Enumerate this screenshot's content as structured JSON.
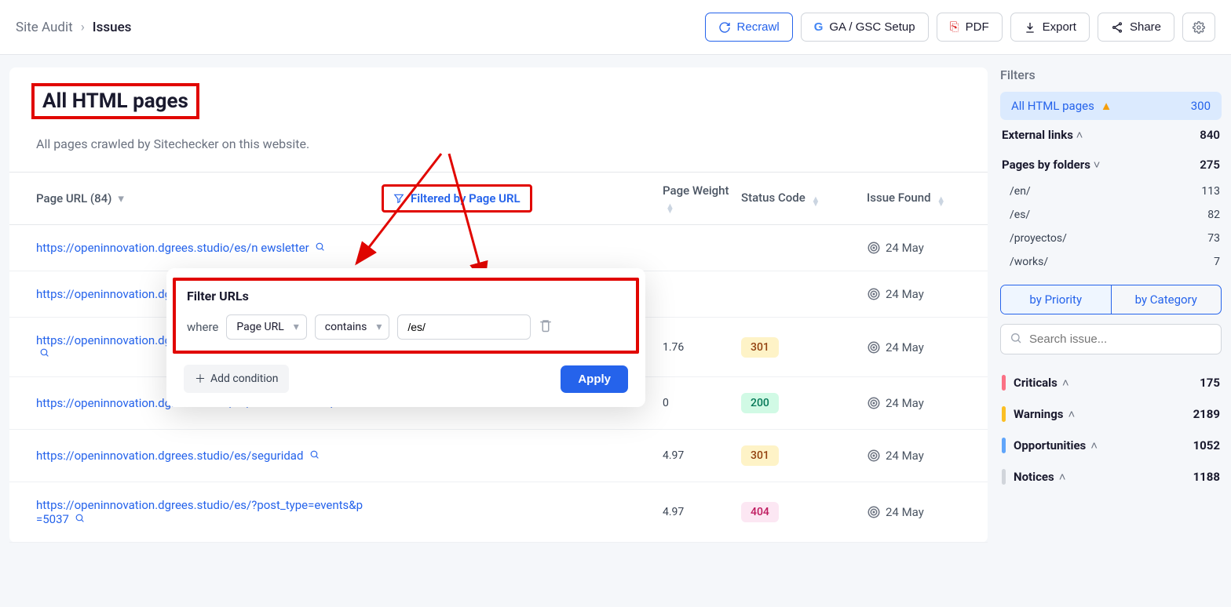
{
  "breadcrumb": {
    "site_audit": "Site Audit",
    "issues": "Issues"
  },
  "actions": {
    "recrawl": "Recrawl",
    "ga_gsc": "GA / GSC Setup",
    "pdf": "PDF",
    "export": "Export",
    "share": "Share"
  },
  "page": {
    "title": "All HTML pages",
    "description": "All pages crawled by Sitechecker on this website."
  },
  "columns": {
    "url": "Page URL (84)",
    "filtered": "Filtered by Page URL",
    "weight": "Page Weight",
    "status": "Status Code",
    "issue": "Issue Found"
  },
  "filter_popup": {
    "title": "Filter URLs",
    "where": "where",
    "field": "Page URL",
    "operator": "contains",
    "value": "/es/",
    "add_condition": "Add condition",
    "apply": "Apply"
  },
  "rows": [
    {
      "url": "https://openinnovation.dgrees.studio/es/n ewsletter",
      "weight": "",
      "status": "",
      "date": "24 May"
    },
    {
      "url": "https://openinnovation.dgrees.studio/es/work s",
      "weight": "",
      "status": "",
      "date": "24 May"
    },
    {
      "url": "https://openinnovation.dgrees.studio/es/tratamiento-de-datos",
      "weight": "1.76",
      "status": "301",
      "date": "24 May"
    },
    {
      "url": "https://openinnovation.dgrees.studio/es/sobre-nosotros/",
      "weight": "0",
      "status": "200",
      "date": "24 May"
    },
    {
      "url": "https://openinnovation.dgrees.studio/es/seguridad",
      "weight": "4.97",
      "status": "301",
      "date": "24 May"
    },
    {
      "url": "https://openinnovation.dgrees.studio/es/?post_type=events&p=5037",
      "weight": "4.97",
      "status": "404",
      "date": "24 May"
    }
  ],
  "sidebar": {
    "filters_title": "Filters",
    "all_html": {
      "label": "All HTML pages",
      "count": "300"
    },
    "external_links": {
      "label": "External links",
      "count": "840"
    },
    "pages_by_folders": {
      "label": "Pages by folders",
      "count": "275"
    },
    "folders": [
      {
        "name": "/en/",
        "count": "113"
      },
      {
        "name": "/es/",
        "count": "82"
      },
      {
        "name": "/proyectos/",
        "count": "73"
      },
      {
        "name": "/works/",
        "count": "7"
      }
    ],
    "tabs": {
      "priority": "by Priority",
      "category": "by Category"
    },
    "search_placeholder": "Search issue...",
    "categories": [
      {
        "name": "Criticals",
        "count": "175",
        "bar": "bar-crit"
      },
      {
        "name": "Warnings",
        "count": "2189",
        "bar": "bar-warn"
      },
      {
        "name": "Opportunities",
        "count": "1052",
        "bar": "bar-opp"
      },
      {
        "name": "Notices",
        "count": "1188",
        "bar": "bar-not"
      }
    ]
  }
}
